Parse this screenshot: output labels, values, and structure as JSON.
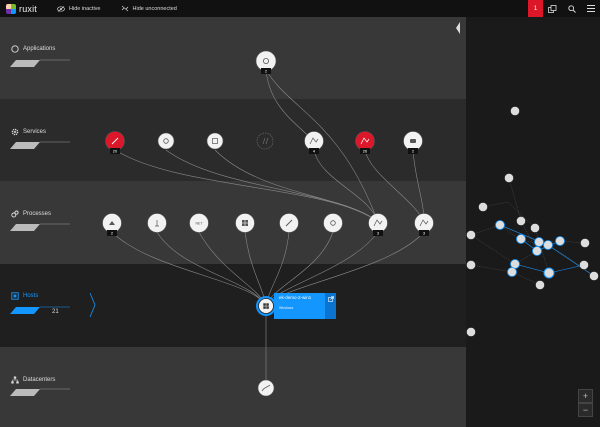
{
  "topbar": {
    "logo_text": "ruxit",
    "hide_inactive": "Hide inactive",
    "hide_unconnected": "Hide unconnected",
    "alert_count": "1"
  },
  "layers": {
    "applications": "Applications",
    "services": "Services",
    "processes": "Processes",
    "hosts": "Hosts",
    "hosts_count": "21",
    "datacenters": "Datacenters"
  },
  "host_card": {
    "name": "ek-demo-2-win1",
    "os": "Windows"
  },
  "node_badges": {
    "app": "2",
    "svc1": "20",
    "svc5": "4",
    "svc6": "26",
    "svc7": "2",
    "proc1": "2",
    "proc8": "3",
    "proc9": "3"
  },
  "node_labels": {
    "proc3": "NET"
  },
  "zoom": {
    "plus": "+",
    "minus": "−"
  },
  "colors": {
    "accent": "#1496ff",
    "alert": "#dc172a",
    "topbar": "#111111"
  }
}
